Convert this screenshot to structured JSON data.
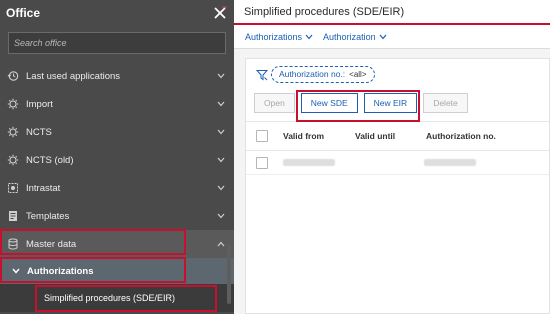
{
  "sidebar": {
    "title": "Office",
    "search_placeholder": "Search office",
    "items": [
      {
        "label": "Last used applications",
        "icon": "history-icon"
      },
      {
        "label": "Import",
        "icon": "import-icon"
      },
      {
        "label": "NCTS",
        "icon": "ncts-icon"
      },
      {
        "label": "NCTS (old)",
        "icon": "ncts-old-icon"
      },
      {
        "label": "Intrastat",
        "icon": "intrastat-icon"
      },
      {
        "label": "Templates",
        "icon": "templates-icon"
      },
      {
        "label": "Master data",
        "icon": "database-icon"
      }
    ],
    "sub_item": "Authorizations",
    "leaf_item": "Simplified procedures (SDE/EIR)"
  },
  "main": {
    "title": "Simplified procedures (SDE/EIR)",
    "tabs": [
      {
        "label": "Authorizations"
      },
      {
        "label": "Authorization"
      }
    ],
    "filter": {
      "label": "Authorization no.:",
      "value": "<all>"
    },
    "buttons": {
      "open": "Open",
      "new_sde": "New SDE",
      "new_eir": "New EIR",
      "delete": "Delete"
    },
    "table": {
      "columns": [
        "Valid from",
        "Valid until",
        "Authorization no."
      ]
    }
  },
  "colors": {
    "accent": "#c8102e",
    "link": "#1a5fb4",
    "sidebar_bg": "#4a4a4a"
  }
}
